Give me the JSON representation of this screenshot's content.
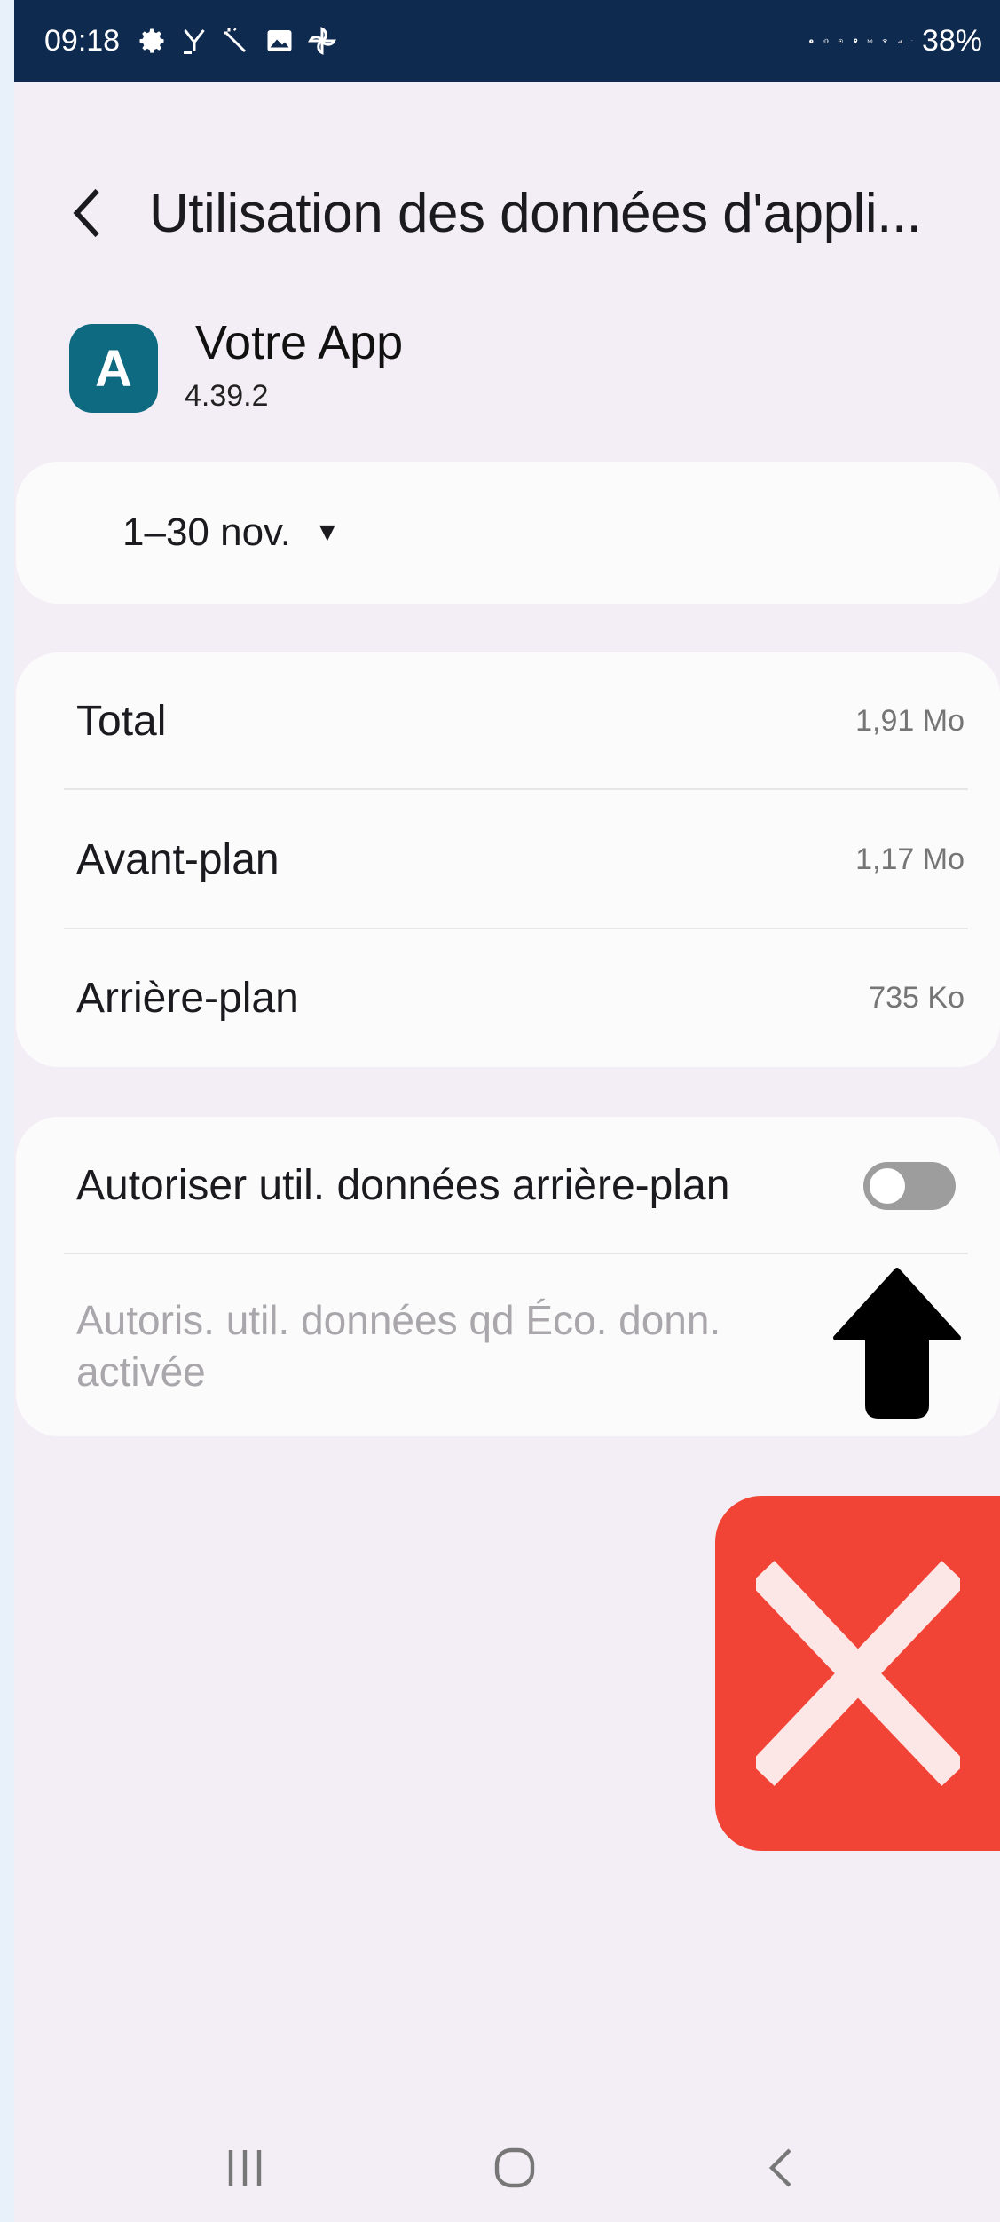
{
  "status_bar": {
    "time": "09:18",
    "battery": "38%",
    "left_icons": [
      "gear-icon",
      "download-icon",
      "magic-wand-icon",
      "gallery-icon",
      "pinwheel-icon"
    ],
    "right_icons": [
      "alarm-icon",
      "vibrate-icon",
      "sync-icon",
      "location-icon",
      "nfc-icon",
      "wifi-icon",
      "signal-icon",
      "battery-icon"
    ]
  },
  "header": {
    "title": "Utilisation des données d'appli..."
  },
  "app": {
    "icon_letter": "A",
    "name": "Votre App",
    "version": "4.39.2",
    "icon_color": "#0e6a80"
  },
  "period": {
    "label": "1–30 nov.",
    "caret": "▼"
  },
  "usage": {
    "rows": [
      {
        "label": "Total",
        "value": "1,91 Mo"
      },
      {
        "label": "Avant-plan",
        "value": "1,17 Mo"
      },
      {
        "label": "Arrière-plan",
        "value": "735 Ko"
      }
    ]
  },
  "background_data": {
    "toggle_label": "Autoriser util. données arrière-plan",
    "toggle_on": false,
    "eco_label": "Autoris. util. données qd Éco. donn. activée"
  },
  "overlay": {
    "accent_red": "#f24436",
    "arrow_color": "#000000"
  }
}
